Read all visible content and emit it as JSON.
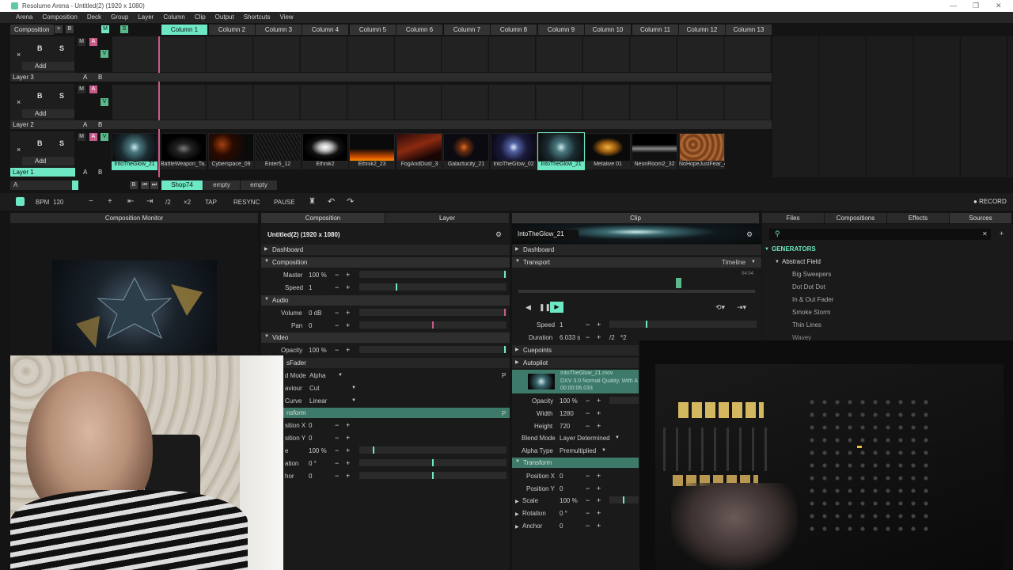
{
  "window": {
    "title": "Resolume Arena - Untitled(2) (1920 x 1080)"
  },
  "menu": [
    "Arena",
    "Composition",
    "Deck",
    "Group",
    "Layer",
    "Column",
    "Clip",
    "Output",
    "Shortcuts",
    "View"
  ],
  "top": {
    "composition_label": "Composition",
    "x": "×",
    "b": "B",
    "m": "M",
    "s": "S"
  },
  "columns": [
    "Column 1",
    "Column 2",
    "Column 3",
    "Column 4",
    "Column 5",
    "Column 6",
    "Column 7",
    "Column 8",
    "Column 9",
    "Column 10",
    "Column 11",
    "Column 12",
    "Column 13"
  ],
  "layer_ctrl": {
    "x": "×",
    "b": "B",
    "s": "S",
    "m": "M",
    "a": "A",
    "v": "V",
    "add": "Add",
    "ab_a": "A",
    "ab_b": "B"
  },
  "layers": [
    {
      "name": "Layer 3"
    },
    {
      "name": "Layer 2"
    },
    {
      "name": "Layer 1"
    }
  ],
  "clips": [
    "IntoTheGlow_21",
    "BattleWeapon_Ta...",
    "Cyberspace_09",
    "Enter5_12",
    "Ethnik2",
    "Ethnik2_23",
    "FogAndDust_3",
    "Galactucity_21",
    "IntoTheGlow_02",
    "IntoTheGlow_21",
    "Metalive 01",
    "NeonRoom2_32",
    "NoHopeJustFear_44"
  ],
  "deck": {
    "a": "A",
    "b": "B",
    "tabs": [
      "Shop74",
      "empty",
      "empty"
    ]
  },
  "transport": {
    "bpm_label": "BPM",
    "bpm": "120",
    "minus": "−",
    "plus": "+",
    "div2": "/2",
    "x2": "×2",
    "tap": "TAP",
    "resync": "RESYNC",
    "pause": "PAUSE",
    "record": "RECORD"
  },
  "panels": {
    "comp_monitor": "Composition Monitor",
    "composition": "Composition",
    "layer": "Layer",
    "clip": "Clip",
    "files": "Files",
    "compositions": "Compositions",
    "effects": "Effects",
    "sources": "Sources"
  },
  "comp_panel": {
    "title": "Untitled(2) (1920 x 1080)",
    "dashboard": "Dashboard",
    "composition": "Composition",
    "master_label": "Master",
    "master": "100 %",
    "speed_label": "Speed",
    "speed": "1",
    "audio": "Audio",
    "volume_label": "Volume",
    "volume": "0 dB",
    "pan_label": "Pan",
    "pan": "0",
    "video": "Video",
    "opacity_label": "Opacity",
    "opacity": "100 %",
    "fader": "sFader",
    "mode_label": "d Mode",
    "mode": "Alpha",
    "behaviour_label": "aviour",
    "behaviour": "Cut",
    "curve_label": "Curve",
    "curve": "Linear",
    "transform": "nsform",
    "posx_label": "sition X",
    "posx": "0",
    "posy_label": "sition Y",
    "posy": "0",
    "scale_label": "e",
    "scale": "100 %",
    "rot_label": "ation",
    "rot": "0 °",
    "anchor_label": "hor",
    "anchor": "0",
    "p": "P"
  },
  "clip_panel": {
    "name": "IntoTheGlow_21",
    "dashboard": "Dashboard",
    "transport": "Transport",
    "timeline": "Timeline",
    "time": "04:04",
    "speed_label": "Speed",
    "speed": "1",
    "duration_label": "Duration",
    "duration": "6.033 s",
    "d2": "/2",
    "x2": "*2",
    "cuepoints": "Cuepoints",
    "autopilot": "Autopilot",
    "file": "IntoTheGlow_21.mov",
    "codec": "DXV 3.0 Normal Quality, With A",
    "length": "00:00:06.033",
    "opacity_label": "Opacity",
    "opacity": "100 %",
    "width_label": "Width",
    "width": "1280",
    "height_label": "Height",
    "height": "720",
    "blend_label": "Blend Mode",
    "blend": "Layer Determined",
    "alpha_label": "Alpha Type",
    "alpha": "Premultiplied",
    "transform": "Transform",
    "posx_label": "Position X",
    "posx": "0",
    "posy_label": "Position Y",
    "posy": "0",
    "scale_label": "Scale",
    "scale": "100 %",
    "rot_label": "Rotation",
    "rot": "0 °",
    "anchor_label": "Anchor",
    "anchor": "0"
  },
  "sources": {
    "search_placeholder": "",
    "generators": "GENERATORS",
    "abstract_field": "Abstract Field",
    "items": [
      "Big Sweepers",
      "Dot Dot Dot",
      "In & Out Fader",
      "Smoke Storm",
      "Thin Lines",
      "Wavey"
    ]
  },
  "colors": {
    "accent": "#6ee8c4",
    "pink": "#c85a8a",
    "bg": "#141414"
  }
}
